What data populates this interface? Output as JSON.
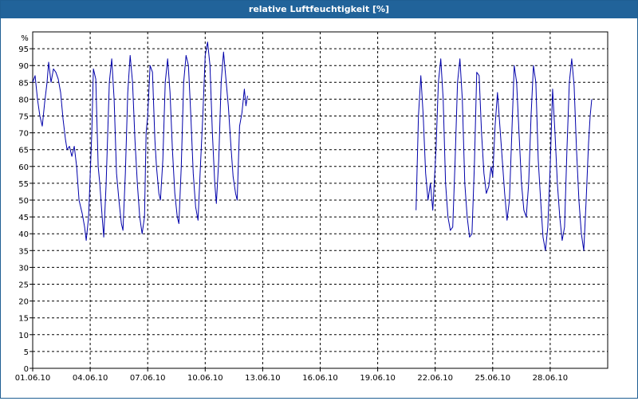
{
  "window": {
    "title": "relative Luftfeuchtigkeit [%]"
  },
  "chart_data": {
    "type": "line",
    "title": "relative Luftfeuchtigkeit [%]",
    "ylabel": "%",
    "ylim": [
      0,
      100
    ],
    "y_ticks": [
      0,
      5,
      10,
      15,
      20,
      25,
      30,
      35,
      40,
      45,
      50,
      55,
      60,
      65,
      70,
      75,
      80,
      85,
      90,
      95
    ],
    "xlim": [
      "01.06.10 00:00",
      "30.06.10 24:00"
    ],
    "x_ticks": [
      "01.06.10",
      "04.06.10",
      "07.06.10",
      "10.06.10",
      "13.06.10",
      "16.06.10",
      "19.06.10",
      "22.06.10",
      "25.06.10",
      "28.06.10"
    ],
    "grid": true,
    "colors": {
      "series": "#0000aa",
      "grid": "#000000",
      "title_bar": "#21639a"
    },
    "series": [
      {
        "segments": [
          [
            [
              "01.06.10 00:00",
              85
            ],
            [
              "01.06.10 03:00",
              87
            ],
            [
              "01.06.10 06:00",
              80
            ],
            [
              "01.06.10 09:00",
              75
            ],
            [
              "01.06.10 12:00",
              72
            ],
            [
              "01.06.10 15:00",
              79
            ],
            [
              "01.06.10 18:00",
              85
            ],
            [
              "01.06.10 20:00",
              91
            ],
            [
              "01.06.10 23:00",
              85
            ],
            [
              "02.06.10 02:00",
              89
            ],
            [
              "02.06.10 05:00",
              88
            ],
            [
              "02.06.10 08:00",
              86
            ],
            [
              "02.06.10 11:00",
              82
            ],
            [
              "02.06.10 14:00",
              74
            ],
            [
              "02.06.10 17:00",
              68
            ],
            [
              "02.06.10 19:00",
              65
            ],
            [
              "02.06.10 22:00",
              66
            ],
            [
              "03.06.10 01:00",
              63
            ],
            [
              "03.06.10 04:00",
              66
            ],
            [
              "03.06.10 07:00",
              60
            ],
            [
              "03.06.10 10:00",
              50
            ],
            [
              "03.06.10 14:00",
              46
            ],
            [
              "03.06.10 17:00",
              42
            ],
            [
              "03.06.10 19:00",
              38
            ],
            [
              "03.06.10 22:00",
              45
            ],
            [
              "04.06.10 02:00",
              70
            ],
            [
              "04.06.10 04:00",
              89
            ],
            [
              "04.06.10 07:00",
              86
            ],
            [
              "04.06.10 10:00",
              60
            ],
            [
              "04.06.10 12:00",
              55
            ],
            [
              "04.06.10 15:00",
              45
            ],
            [
              "04.06.10 17:00",
              39
            ],
            [
              "04.06.10 20:00",
              55
            ],
            [
              "05.06.10 00:00",
              85
            ],
            [
              "05.06.10 03:00",
              92
            ],
            [
              "05.06.10 06:00",
              80
            ],
            [
              "05.06.10 09:00",
              58
            ],
            [
              "05.06.10 12:00",
              50
            ],
            [
              "05.06.10 15:00",
              43
            ],
            [
              "05.06.10 17:00",
              41
            ],
            [
              "05.06.10 20:00",
              58
            ],
            [
              "05.06.10 23:00",
              82
            ],
            [
              "06.06.10 02:00",
              93
            ],
            [
              "06.06.10 05:00",
              85
            ],
            [
              "06.06.10 08:00",
              68
            ],
            [
              "06.06.10 11:00",
              55
            ],
            [
              "06.06.10 14:00",
              45
            ],
            [
              "06.06.10 17:00",
              40
            ],
            [
              "06.06.10 20:00",
              45
            ],
            [
              "06.06.10 22:00",
              70
            ],
            [
              "07.06.10 00:00",
              75
            ],
            [
              "07.06.10 03:00",
              90
            ],
            [
              "07.06.10 06:00",
              88
            ],
            [
              "07.06.10 09:00",
              68
            ],
            [
              "07.06.10 11:00",
              60
            ],
            [
              "07.06.10 14:00",
              52
            ],
            [
              "07.06.10 16:00",
              50
            ],
            [
              "07.06.10 19:00",
              62
            ],
            [
              "07.06.10 22:00",
              85
            ],
            [
              "08.06.10 01:00",
              92
            ],
            [
              "08.06.10 04:00",
              82
            ],
            [
              "08.06.10 07:00",
              65
            ],
            [
              "08.06.10 10:00",
              52
            ],
            [
              "08.06.10 13:00",
              45
            ],
            [
              "08.06.10 15:00",
              43
            ],
            [
              "08.06.10 18:00",
              60
            ],
            [
              "08.06.10 21:00",
              85
            ],
            [
              "09.06.10 00:00",
              93
            ],
            [
              "09.06.10 03:00",
              90
            ],
            [
              "09.06.10 06:00",
              75
            ],
            [
              "09.06.10 09:00",
              58
            ],
            [
              "09.06.10 12:00",
              48
            ],
            [
              "09.06.10 15:00",
              44
            ],
            [
              "09.06.10 18:00",
              60
            ],
            [
              "09.06.10 21:00",
              75
            ],
            [
              "10.06.10 00:00",
              93
            ],
            [
              "10.06.10 03:00",
              97
            ],
            [
              "10.06.10 06:00",
              90
            ],
            [
              "10.06.10 09:00",
              70
            ],
            [
              "10.06.10 12:00",
              55
            ],
            [
              "10.06.10 14:00",
              49
            ],
            [
              "10.06.10 17:00",
              62
            ],
            [
              "10.06.10 20:00",
              85
            ],
            [
              "10.06.10 23:00",
              94
            ],
            [
              "11.06.10 02:00",
              86
            ],
            [
              "11.06.10 05:00",
              78
            ],
            [
              "11.06.10 08:00",
              67
            ],
            [
              "11.06.10 11:00",
              57
            ],
            [
              "11.06.10 14:00",
              52
            ],
            [
              "11.06.10 16:00",
              50
            ],
            [
              "11.06.10 19:00",
              72
            ],
            [
              "11.06.10 22:00",
              76
            ],
            [
              "12.06.10 01:00",
              83
            ],
            [
              "12.06.10 03:00",
              78
            ],
            [
              "12.06.10 05:00",
              81
            ]
          ],
          [
            [
              "21.06.10 00:00",
              47
            ],
            [
              "21.06.10 03:00",
              75
            ],
            [
              "21.06.10 06:00",
              87
            ],
            [
              "21.06.10 09:00",
              75
            ],
            [
              "21.06.10 12:00",
              58
            ],
            [
              "21.06.10 15:00",
              50
            ],
            [
              "21.06.10 18:00",
              55
            ],
            [
              "21.06.10 21:00",
              47
            ],
            [
              "22.06.10 01:00",
              65
            ],
            [
              "22.06.10 04:00",
              85
            ],
            [
              "22.06.10 07:00",
              92
            ],
            [
              "22.06.10 10:00",
              80
            ],
            [
              "22.06.10 13:00",
              55
            ],
            [
              "22.06.10 16:00",
              45
            ],
            [
              "22.06.10 19:00",
              41
            ],
            [
              "22.06.10 22:00",
              42
            ],
            [
              "23.06.10 01:00",
              62
            ],
            [
              "23.06.10 04:00",
              85
            ],
            [
              "23.06.10 07:00",
              92
            ],
            [
              "23.06.10 10:00",
              80
            ],
            [
              "23.06.10 13:00",
              55
            ],
            [
              "23.06.10 16:00",
              45
            ],
            [
              "23.06.10 19:00",
              39
            ],
            [
              "23.06.10 22:00",
              40
            ],
            [
              "24.06.10 01:00",
              60
            ],
            [
              "24.06.10 04:00",
              88
            ],
            [
              "24.06.10 07:00",
              87
            ],
            [
              "24.06.10 10:00",
              70
            ],
            [
              "24.06.10 13:00",
              58
            ],
            [
              "24.06.10 16:00",
              52
            ],
            [
              "24.06.10 19:00",
              54
            ],
            [
              "24.06.10 22:00",
              60
            ],
            [
              "25.06.10 00:00",
              57
            ],
            [
              "25.06.10 03:00",
              72
            ],
            [
              "25.06.10 06:00",
              82
            ],
            [
              "25.06.10 09:00",
              72
            ],
            [
              "25.06.10 12:00",
              62
            ],
            [
              "25.06.10 15:00",
              52
            ],
            [
              "25.06.10 18:00",
              44
            ],
            [
              "25.06.10 21:00",
              50
            ],
            [
              "26.06.10 00:00",
              70
            ],
            [
              "26.06.10 03:00",
              90
            ],
            [
              "26.06.10 06:00",
              85
            ],
            [
              "26.06.10 09:00",
              70
            ],
            [
              "26.06.10 12:00",
              55
            ],
            [
              "26.06.10 15:00",
              47
            ],
            [
              "26.06.10 18:00",
              45
            ],
            [
              "26.06.10 21:00",
              55
            ],
            [
              "27.06.10 00:00",
              75
            ],
            [
              "27.06.10 03:00",
              90
            ],
            [
              "27.06.10 06:00",
              85
            ],
            [
              "27.06.10 09:00",
              62
            ],
            [
              "27.06.10 12:00",
              50
            ],
            [
              "27.06.10 15:00",
              39
            ],
            [
              "27.06.10 18:00",
              35
            ],
            [
              "27.06.10 21:00",
              42
            ],
            [
              "28.06.10 00:00",
              60
            ],
            [
              "28.06.10 03:00",
              83
            ],
            [
              "28.06.10 06:00",
              70
            ],
            [
              "28.06.10 09:00",
              55
            ],
            [
              "28.06.10 12:00",
              45
            ],
            [
              "28.06.10 15:00",
              38
            ],
            [
              "28.06.10 18:00",
              42
            ],
            [
              "28.06.10 21:00",
              65
            ],
            [
              "29.06.10 00:00",
              85
            ],
            [
              "29.06.10 03:00",
              92
            ],
            [
              "29.06.10 06:00",
              84
            ],
            [
              "29.06.10 09:00",
              65
            ],
            [
              "29.06.10 12:00",
              50
            ],
            [
              "29.06.10 15:00",
              40
            ],
            [
              "29.06.10 18:00",
              35
            ],
            [
              "29.06.10 21:00",
              50
            ],
            [
              "30.06.10 00:00",
              67
            ],
            [
              "30.06.10 02:00",
              75
            ],
            [
              "30.06.10 04:00",
              80
            ]
          ]
        ]
      }
    ]
  }
}
